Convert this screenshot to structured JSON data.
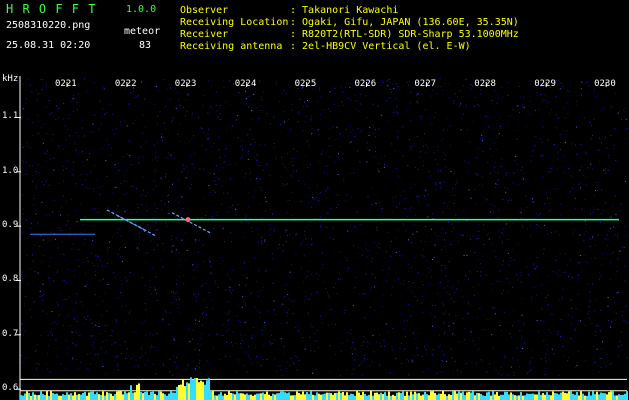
{
  "header": {
    "app_name": "H R O F F T",
    "version": "1.0.0",
    "filename": "2508310220.png",
    "datetime": "25.08.31 02:20",
    "event_label": "meteor",
    "event_count": "83",
    "info": [
      {
        "label": "Observer",
        "value": ": Takanori Kawachi"
      },
      {
        "label": "Receiving Location",
        "value": ": Ogaki, Gifu, JAPAN (136.60E, 35.35N)"
      },
      {
        "label": "Receiver",
        "value": ": R820T2(RTL-SDR) SDR-Sharp 53.1000MHz"
      },
      {
        "label": "Receiving antenna",
        "value": ": 2el-HB9CV Vertical (el. E-W)"
      }
    ]
  },
  "chart_data": {
    "type": "heatmap",
    "y_unit": "kHz",
    "x_ticks": [
      "0221",
      "0222",
      "0223",
      "0224",
      "0225",
      "0226",
      "0227",
      "0228",
      "0229",
      "0230"
    ],
    "y_ticks": [
      "1.1",
      "1.0",
      "0.9",
      "0.8",
      "0.7",
      "0.6"
    ],
    "ylim": [
      0.58,
      1.18
    ],
    "carrier_khz": 0.912,
    "secondary_carrier_khz": 0.885,
    "lower_bands_khz": [
      0.618,
      0.597
    ],
    "echoes": [
      {
        "time": "02:22.0",
        "khz": 0.915
      },
      {
        "time": "02:22.5",
        "khz": 0.905
      },
      {
        "time": "02:23.1",
        "khz": 0.91
      }
    ]
  },
  "colors": {
    "background": "#000000",
    "noise": "#1a1aff",
    "carrier": "#33ff99",
    "band": "#ffffcc",
    "text_green": "#3cff3c",
    "text_white": "#ffffff",
    "text_yellow": "#ffff00"
  }
}
